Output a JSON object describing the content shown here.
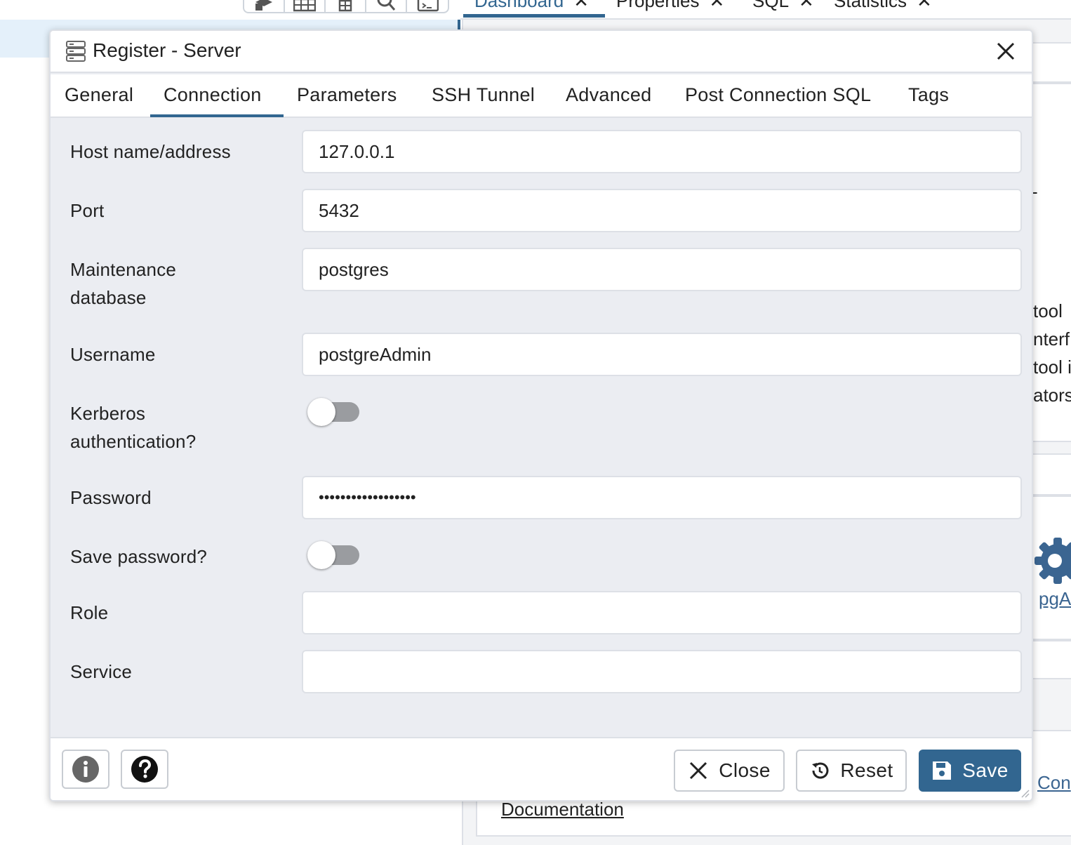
{
  "background": {
    "tabs": [
      {
        "label": "Dashboard"
      },
      {
        "label": "Properties"
      },
      {
        "label": "SQL"
      },
      {
        "label": "Statistics"
      }
    ],
    "fragments": {
      "dash": "-",
      "line1": "tool",
      "line2": "nterf",
      "line3": "tool i",
      "line4": "ators",
      "pga": "pgA",
      "con": "Con",
      "documentation": "Documentation"
    },
    "toolbar_icons": [
      "object-explorer-icon",
      "table-icon",
      "grid-icon",
      "search-icon",
      "terminal-icon"
    ]
  },
  "dialog": {
    "title": "Register - Server",
    "tabs": [
      "General",
      "Connection",
      "Parameters",
      "SSH Tunnel",
      "Advanced",
      "Post Connection SQL",
      "Tags"
    ],
    "active_tab": "Connection",
    "fields": {
      "host": {
        "label": "Host name/address",
        "value": "127.0.0.1"
      },
      "port": {
        "label": "Port",
        "value": "5432"
      },
      "maintenance_db": {
        "label_line1": "Maintenance",
        "label_line2": "database",
        "value": "postgres"
      },
      "username": {
        "label": "Username",
        "value": "postgreAdmin"
      },
      "kerberos": {
        "label_line1": "Kerberos",
        "label_line2": "authentication?",
        "value": false
      },
      "password": {
        "label": "Password",
        "value": "••••••••••••••••••"
      },
      "save_password": {
        "label": "Save password?",
        "value": false
      },
      "role": {
        "label": "Role",
        "value": ""
      },
      "service": {
        "label": "Service",
        "value": ""
      }
    },
    "footer": {
      "info_icon": "info-icon",
      "help_icon": "help-icon",
      "close_label": "Close",
      "reset_label": "Reset",
      "save_label": "Save"
    },
    "colors": {
      "accent": "#326690",
      "panel": "#ebedf2",
      "border": "#dde0e6",
      "toggle_off": "#9a9ca0"
    }
  }
}
